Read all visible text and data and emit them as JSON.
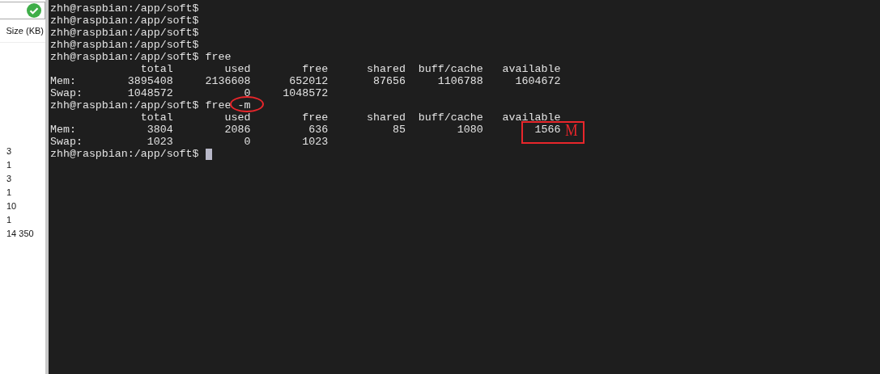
{
  "file_panel": {
    "column_header": "Size (KB)",
    "sizes": [
      "3",
      "1",
      "3",
      "1",
      "10",
      "1",
      "14 350"
    ]
  },
  "terminal": {
    "lines": [
      "zhh@raspbian:/app/soft$",
      "zhh@raspbian:/app/soft$",
      "zhh@raspbian:/app/soft$",
      "zhh@raspbian:/app/soft$",
      "zhh@raspbian:/app/soft$ free",
      "              total        used        free      shared  buff/cache   available",
      "Mem:        3895408     2136608      652012       87656     1106788     1604672",
      "Swap:       1048572           0     1048572",
      "zhh@raspbian:/app/soft$ free -m",
      "              total        used        free      shared  buff/cache   available",
      "Mem:           3804        2086         636          85        1080        1566",
      "Swap:          1023           0        1023",
      "zhh@raspbian:/app/soft$ "
    ],
    "cursor_visible": true
  },
  "annotations": {
    "unit_label": "M"
  }
}
